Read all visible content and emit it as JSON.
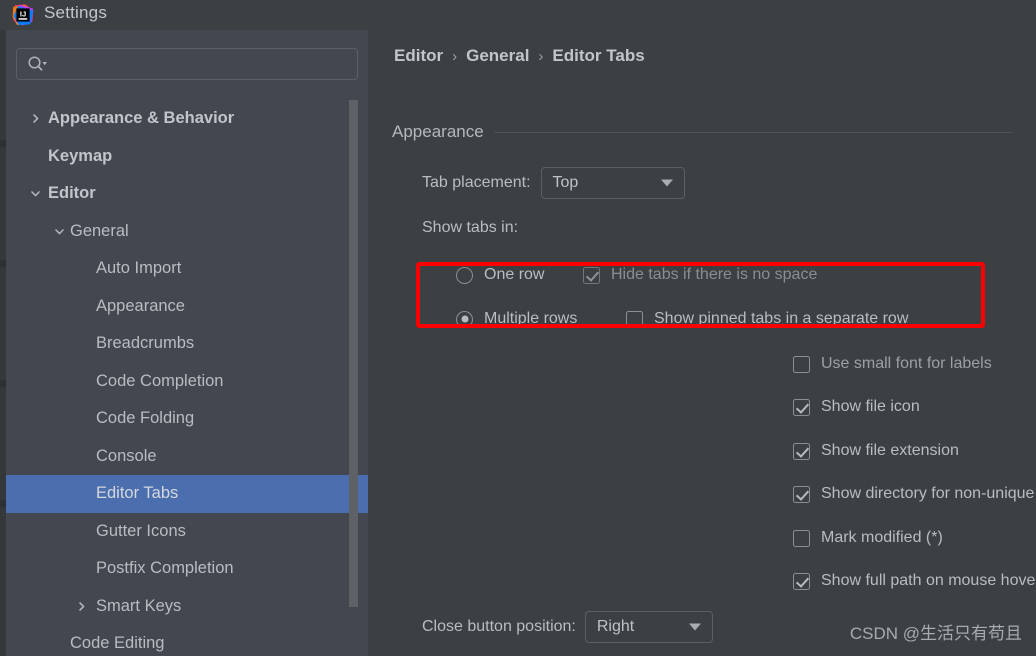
{
  "window": {
    "title": "Settings",
    "logo_icon": "intellij-idea-logo-icon"
  },
  "sidebar": {
    "search": {
      "placeholder": "",
      "value": "",
      "icon": "search-icon",
      "dropdown_icon": "caret-down-icon"
    },
    "items": [
      {
        "label": "Appearance & Behavior",
        "level": 0,
        "arrow": "chevron-right",
        "selected": false
      },
      {
        "label": "Keymap",
        "level": 0,
        "arrow": "none",
        "selected": false
      },
      {
        "label": "Editor",
        "level": 0,
        "arrow": "chevron-down",
        "selected": false
      },
      {
        "label": "General",
        "level": 1,
        "arrow": "chevron-down",
        "selected": false
      },
      {
        "label": "Auto Import",
        "level": 2,
        "arrow": "none",
        "selected": false
      },
      {
        "label": "Appearance",
        "level": 2,
        "arrow": "none",
        "selected": false
      },
      {
        "label": "Breadcrumbs",
        "level": 2,
        "arrow": "none",
        "selected": false
      },
      {
        "label": "Code Completion",
        "level": 2,
        "arrow": "none",
        "selected": false
      },
      {
        "label": "Code Folding",
        "level": 2,
        "arrow": "none",
        "selected": false
      },
      {
        "label": "Console",
        "level": 2,
        "arrow": "none",
        "selected": false
      },
      {
        "label": "Editor Tabs",
        "level": 2,
        "arrow": "none",
        "selected": true
      },
      {
        "label": "Gutter Icons",
        "level": 2,
        "arrow": "none",
        "selected": false
      },
      {
        "label": "Postfix Completion",
        "level": 2,
        "arrow": "none",
        "selected": false
      },
      {
        "label": "Smart Keys",
        "level": 2,
        "arrow": "chevron-right",
        "selected": false
      },
      {
        "label": "Code Editing",
        "level": 1,
        "arrow": "none",
        "selected": false
      }
    ]
  },
  "main": {
    "breadcrumb": {
      "items": [
        "Editor",
        "General",
        "Editor Tabs"
      ],
      "separator": "›"
    },
    "section": {
      "title": "Appearance"
    },
    "tab_placement": {
      "label": "Tab placement:",
      "value": "Top"
    },
    "show_tabs_in": {
      "label": "Show tabs in:",
      "one_row": {
        "label": "One row",
        "checked": false
      },
      "multiple_rows": {
        "label": "Multiple rows",
        "checked": true
      },
      "hide_tabs_no_space": {
        "label": "Hide tabs if there is no space",
        "checked": true,
        "disabled": true
      },
      "pinned_separate_row": {
        "label": "Show pinned tabs in a separate row",
        "checked": false,
        "disabled": false
      }
    },
    "checkboxes": [
      {
        "label": "Use small font for labels",
        "checked": false
      },
      {
        "label": "Show file icon",
        "checked": true
      },
      {
        "label": "Show file extension",
        "checked": true
      },
      {
        "label": "Show directory for non-unique file names",
        "checked": true
      },
      {
        "label": "Mark modified (*)",
        "checked": false
      },
      {
        "label": "Show full path on mouse hover",
        "checked": true
      }
    ],
    "close_button_position": {
      "label": "Close button position:",
      "value": "Right"
    }
  },
  "annotation": {
    "highlight_color": "#fb0000"
  },
  "watermark": {
    "text": "CSDN @生活只有苟且"
  },
  "colors": {
    "window_bg": "#3c4043",
    "sidebar_bg": "#434750",
    "selection_blue": "#4b6eaf",
    "text": "#b9bcc0",
    "border": "#5c6063"
  }
}
